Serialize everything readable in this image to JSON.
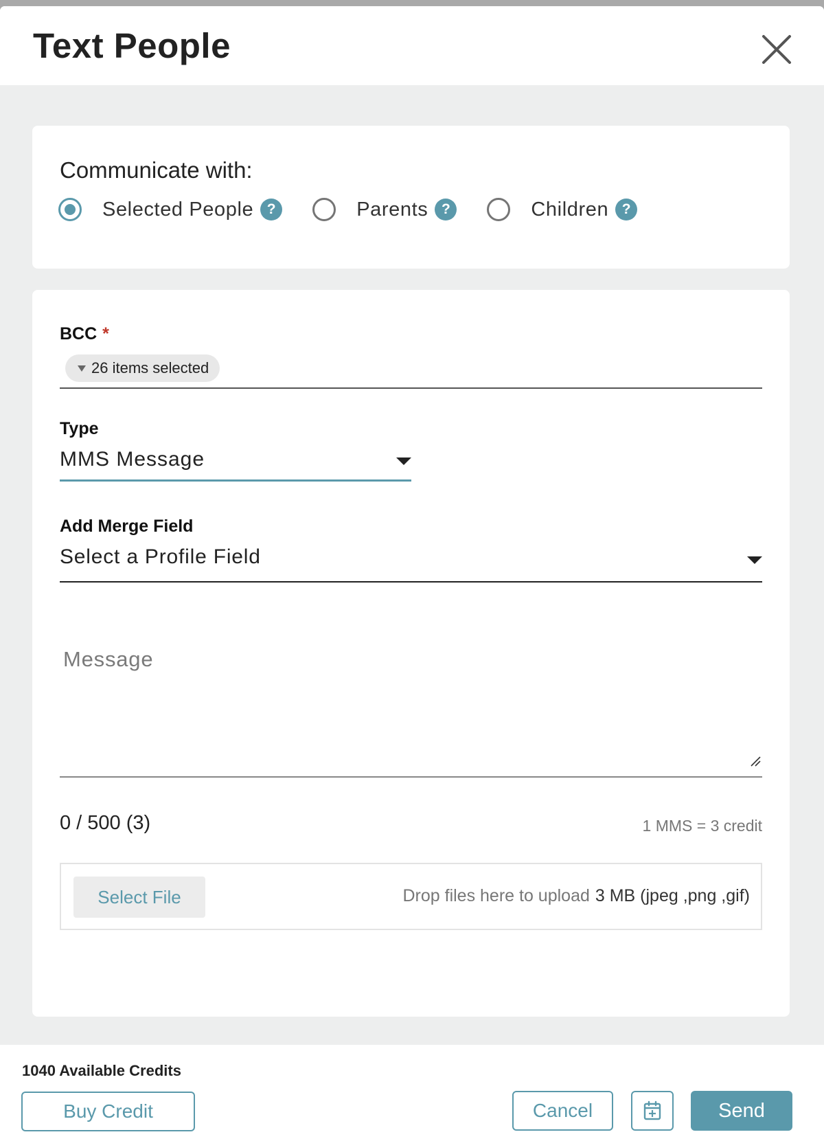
{
  "dialog": {
    "title": "Text People"
  },
  "communicate": {
    "label": "Communicate with:",
    "options": [
      {
        "label": "Selected People",
        "selected": true
      },
      {
        "label": "Parents",
        "selected": false
      },
      {
        "label": "Children",
        "selected": false
      }
    ],
    "help_glyph": "?"
  },
  "bcc": {
    "label": "BCC",
    "required_mark": "*",
    "chip_text": "26 items selected"
  },
  "type": {
    "label": "Type",
    "value": "MMS Message"
  },
  "merge_field": {
    "label": "Add Merge Field",
    "value": "Select a Profile Field"
  },
  "message": {
    "placeholder": "Message",
    "value": ""
  },
  "counter": {
    "text": "0 / 500 (3)",
    "credit_note": "1 MMS = 3 credit"
  },
  "upload": {
    "button_label": "Select File",
    "drop_text": "Drop files here to upload",
    "limit_text": "3 MB (jpeg ,png ,gif)"
  },
  "footer": {
    "credits_text": "1040 Available Credits",
    "buy_label": "Buy Credit",
    "cancel_label": "Cancel",
    "send_label": "Send"
  },
  "icons": {
    "close": "close-icon",
    "help": "help-icon",
    "schedule": "calendar-add-icon",
    "resize": "resize-handle-icon"
  },
  "colors": {
    "accent": "#5a99ab",
    "body_background": "#edeeee",
    "required": "#c0392b"
  }
}
